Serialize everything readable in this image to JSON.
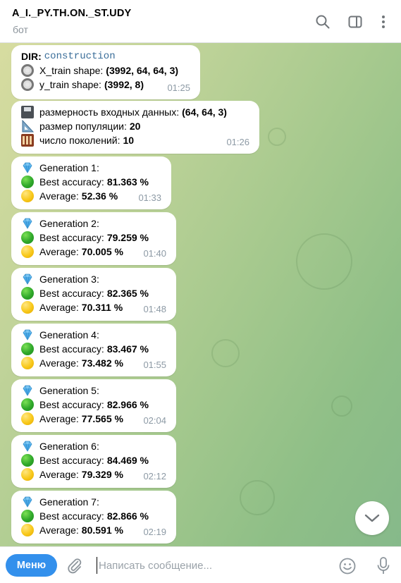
{
  "header": {
    "title": "A_I._PY.TH.ON._ST.UDY",
    "subtitle": "бот"
  },
  "messages": [
    {
      "lines": [
        {
          "label": "DIR:",
          "code": "construction"
        },
        {
          "icon": "radio-button",
          "label": "X_train shape:",
          "value": "(3992, 64, 64, 3)"
        },
        {
          "icon": "radio-button",
          "label": "y_train shape:",
          "value": "(3992, 8)"
        }
      ],
      "time": "01:25"
    },
    {
      "lines": [
        {
          "icon": "floppy-disk",
          "label": "размерность входных данных:",
          "value": "(64, 64, 3)"
        },
        {
          "icon": "triangular-ruler",
          "label": "размер популяции:",
          "value": "20"
        },
        {
          "icon": "abacus",
          "label": "число поколений:",
          "value": "10"
        }
      ],
      "time": "01:26"
    },
    {
      "generation": "Generation 1:",
      "best_label": "Best accuracy:",
      "best": "81.363 %",
      "avg_label": "Average:",
      "avg": "52.36 %",
      "time": "01:33"
    },
    {
      "generation": "Generation 2:",
      "best_label": "Best accuracy:",
      "best": "79.259 %",
      "avg_label": "Average:",
      "avg": "70.005 %",
      "time": "01:40"
    },
    {
      "generation": "Generation 3:",
      "best_label": "Best accuracy:",
      "best": "82.365 %",
      "avg_label": "Average:",
      "avg": "70.311 %",
      "time": "01:48"
    },
    {
      "generation": "Generation 4:",
      "best_label": "Best accuracy:",
      "best": "83.467 %",
      "avg_label": "Average:",
      "avg": "73.482 %",
      "time": "01:55"
    },
    {
      "generation": "Generation 5:",
      "best_label": "Best accuracy:",
      "best": "82.966 %",
      "avg_label": "Average:",
      "avg": "77.565 %",
      "time": "02:04"
    },
    {
      "generation": "Generation 6:",
      "best_label": "Best accuracy:",
      "best": "84.469 %",
      "avg_label": "Average:",
      "avg": "79.329 %",
      "time": "02:12"
    },
    {
      "generation": "Generation 7:",
      "best_label": "Best accuracy:",
      "best": "82.866 %",
      "avg_label": "Average:",
      "avg": "80.591 %",
      "time": "02:19"
    }
  ],
  "composer": {
    "menu_label": "Меню",
    "placeholder": "Написать сообщение..."
  },
  "icons": {
    "generation": "gem-stone-icon",
    "best": "green-circle-icon",
    "average": "yellow-circle-icon"
  },
  "colors": {
    "accent": "#3390ec",
    "code": "#3a6d99",
    "time": "#8d9aa5"
  }
}
